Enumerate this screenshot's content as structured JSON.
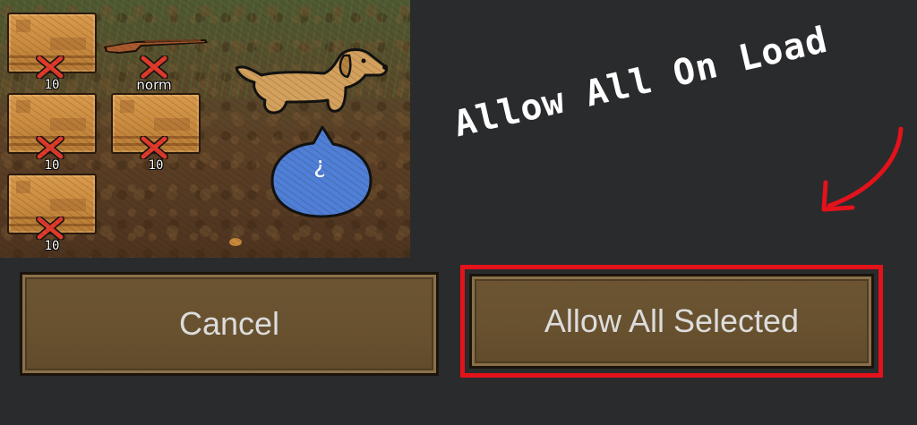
{
  "game_view": {
    "items": [
      {
        "kind": "crate",
        "count": "10",
        "forbidden": true
      },
      {
        "kind": "rifle",
        "count": "norm",
        "forbidden": true
      },
      {
        "kind": "crate",
        "count": "10",
        "forbidden": true
      },
      {
        "kind": "crate",
        "count": "10",
        "forbidden": true
      },
      {
        "kind": "crate",
        "count": "10",
        "forbidden": true
      }
    ],
    "dog": {
      "icon": "dog-icon"
    },
    "speech_bubble": {
      "text": "¿",
      "color": "#4f7fd6"
    }
  },
  "annotation": {
    "text": "Allow All On Load",
    "arrow_color": "#e3121b"
  },
  "buttons": {
    "cancel_label": "Cancel",
    "allow_all_selected_label": "Allow All Selected",
    "highlight_color": "#e3121b"
  },
  "colors": {
    "background": "#2a2b2d",
    "button_fill": "#68512f",
    "forbid_x": "#e03a2a"
  }
}
